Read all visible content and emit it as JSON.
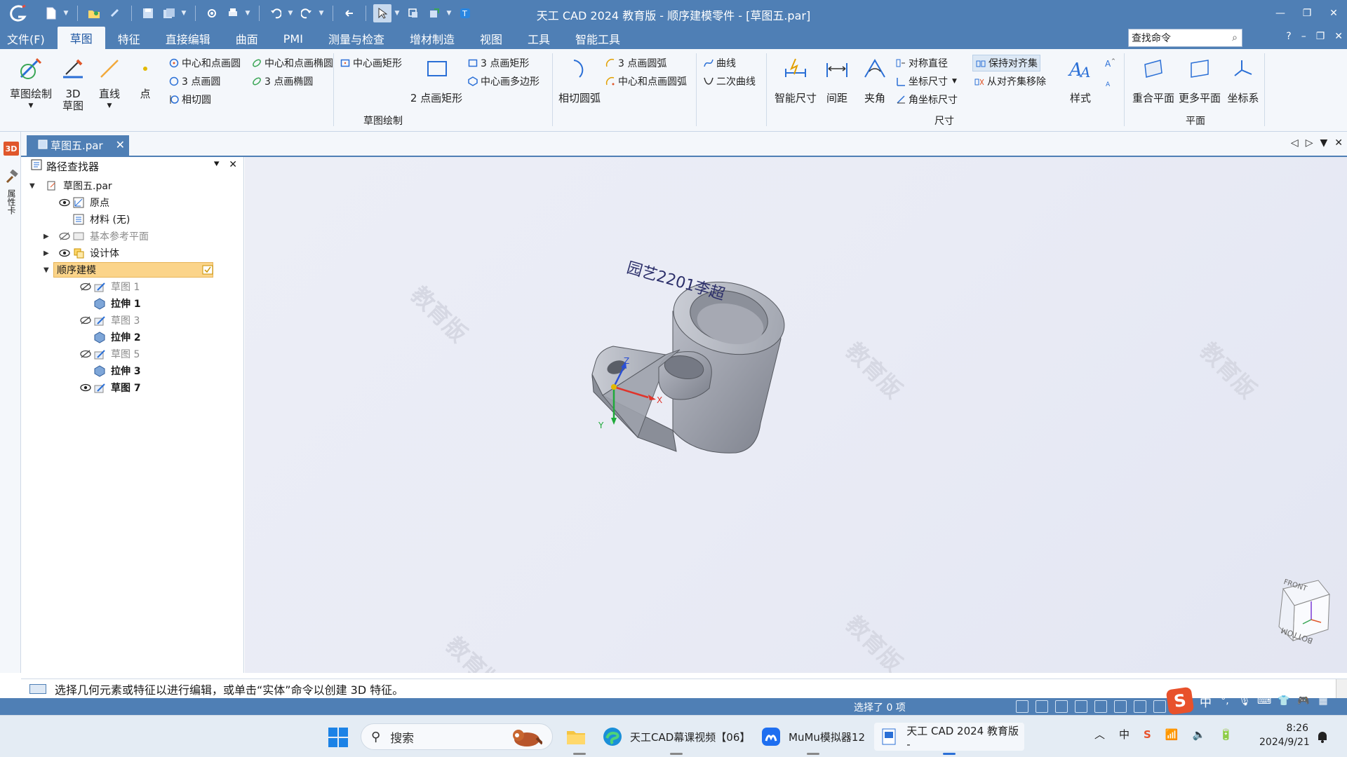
{
  "window": {
    "title": "天工 CAD 2024 教育版 - 顺序建模零件 - [草图五.par]"
  },
  "menu": {
    "file": "文件(F)",
    "tabs": [
      "草图",
      "特征",
      "直接编辑",
      "曲面",
      "PMI",
      "测量与检查",
      "增材制造",
      "视图",
      "工具",
      "智能工具"
    ],
    "active_tab": "草图",
    "search_value": "查找命令",
    "help": "?"
  },
  "ribbon": {
    "sketch_group": {
      "label": "草图绘制",
      "sketch_draw": "草图绘制",
      "sketch_3d_line1": "3D",
      "sketch_3d_line2": "草图",
      "line": "直线",
      "point": "点",
      "center_circle": "中心和点画圆",
      "three_point_circle": "3 点画圆",
      "tangent_circle": "相切圆",
      "center_ellipse": "中心和点画椭圆",
      "three_point_ellipse": "3 点画椭圆",
      "center_rect": "中心画矩形",
      "two_point_rect": "2 点画矩形",
      "three_point_rect": "3 点画矩形",
      "center_polygon": "中心画多边形",
      "tangent_arc": "相切圆弧",
      "three_point_arc": "3 点画圆弧",
      "center_arc": "中心和点画圆弧",
      "curve": "曲线",
      "conic": "二次曲线"
    },
    "dimension_group": {
      "label": "尺寸",
      "smart_dim": "智能尺寸",
      "spacing": "间距",
      "angle": "夹角",
      "sym_diameter": "对称直径",
      "coord_dim": "坐标尺寸",
      "angle_coord": "角坐标尺寸",
      "keep_align": "保持对齐集",
      "remove_align": "从对齐集移除",
      "style": "样式"
    },
    "plane_group": {
      "label": "平面",
      "coincident_plane": "重合平面",
      "more_planes": "更多平面",
      "coord_sys": "坐标系"
    }
  },
  "left_strip": {
    "badge": "3D",
    "label": "属性卡"
  },
  "doc_tab": {
    "name": "草图五.par",
    "close": "✕"
  },
  "pathfinder": {
    "title": "路径查找器",
    "items": [
      {
        "label": "草图五.par",
        "level": 0
      },
      {
        "label": "原点",
        "level": 1
      },
      {
        "label": "材料 (无)",
        "level": 1
      },
      {
        "label": "基本参考平面",
        "level": 1
      },
      {
        "label": "设计体",
        "level": 1
      },
      {
        "label": "顺序建模",
        "level": 1
      },
      {
        "label": "草图 1",
        "level": 2
      },
      {
        "label": "拉伸 1",
        "level": 2
      },
      {
        "label": "草图 3",
        "level": 2
      },
      {
        "label": "拉伸 2",
        "level": 2
      },
      {
        "label": "草图 5",
        "level": 2
      },
      {
        "label": "拉伸 3",
        "level": 2
      },
      {
        "label": "草图 7",
        "level": 2
      }
    ]
  },
  "viewport": {
    "watermark": "教育版",
    "annotation_text": "园艺2201李超",
    "axis_x": "X",
    "axis_y": "Y",
    "axis_z": "Z",
    "cube_front": "FRONT",
    "cube_bottom": "BOTTOM"
  },
  "prompt": {
    "text": "选择几何元素或特征以进行编辑，或单击“实体”命令以创建 3D 特征。"
  },
  "status": {
    "selection": "选择了 0 项",
    "ime_mode": "中"
  },
  "taskbar": {
    "search_placeholder": "搜索",
    "items": [
      {
        "label": "天工CAD幕课视频【06】"
      },
      {
        "label": "MuMu模拟器12"
      },
      {
        "label": "天工 CAD 2024 教育版 -"
      }
    ],
    "tray_lang": "中",
    "time": "8:26",
    "date": "2024/9/21"
  },
  "colors": {
    "accent": "#4f7fb5",
    "ribbon_bg": "#f4f7fb",
    "selected_item": "#fbd48a",
    "model_gray": "#9fa3ae",
    "axis_x": "#e0342b",
    "axis_y": "#1faa3a",
    "axis_z": "#2a4fd6"
  }
}
